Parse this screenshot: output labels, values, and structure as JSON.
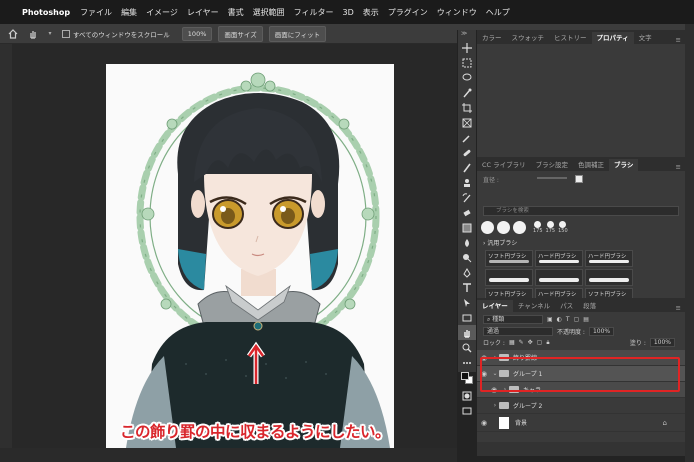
{
  "menubar": {
    "app_name": "Photoshop",
    "items": [
      "ファイル",
      "編集",
      "イメージ",
      "レイヤー",
      "書式",
      "選択範囲",
      "フィルター",
      "3D",
      "表示",
      "プラグイン",
      "ウィンドウ",
      "ヘルプ"
    ]
  },
  "options_bar": {
    "scroll_all_label": "すべてのウィンドウをスクロール",
    "zoom_value": "100%",
    "fit_screen_label": "画面サイズ",
    "fill_screen_label": "画面にフィット"
  },
  "annotation": {
    "text": "この飾り罫の中に収まるようにしたい。",
    "color": "#d9262c"
  },
  "top_panel": {
    "tabs": [
      "カラー",
      "スウォッチ",
      "ヒストリー",
      "プロパティ",
      "文字"
    ],
    "active_tab": "プロパティ"
  },
  "brush_panel": {
    "tabs": [
      "CC ライブラリ",
      "ブラシ設定",
      "色調補正",
      "ブラシ"
    ],
    "active_tab": "ブラシ",
    "size_label": "直径 :",
    "search_placeholder": "ブラシを検索",
    "tip_sizes": [
      "175",
      "175",
      "150"
    ],
    "group_name": "汎用ブラシ",
    "presets": [
      "ソフト円ブラシ",
      "ハード円ブラシ",
      "ハード円ブラシ",
      "",
      "",
      "",
      "ソフト円ブラシ",
      "ハード円ブラシ",
      "ソフト円ブラシ"
    ]
  },
  "layers_panel": {
    "tabs": [
      "レイヤー",
      "チャンネル",
      "パス",
      "段落"
    ],
    "active_tab": "レイヤー",
    "filter_label": "種類",
    "blend_mode": "通過",
    "opacity_label": "不透明度 :",
    "opacity_value": "100%",
    "lock_label": "ロック :",
    "fill_label": "塗り :",
    "fill_value": "100%",
    "layers": [
      {
        "name": "飾り罫線",
        "kind": "group",
        "visible": true
      },
      {
        "name": "グループ 1",
        "kind": "group",
        "visible": true,
        "expanded": true
      },
      {
        "name": "キャラ",
        "kind": "group",
        "visible": true
      },
      {
        "name": "グループ 2",
        "kind": "group",
        "visible": false
      },
      {
        "name": "背景",
        "kind": "background",
        "visible": true,
        "locked": true
      }
    ],
    "highlight_color": "#e02424"
  }
}
